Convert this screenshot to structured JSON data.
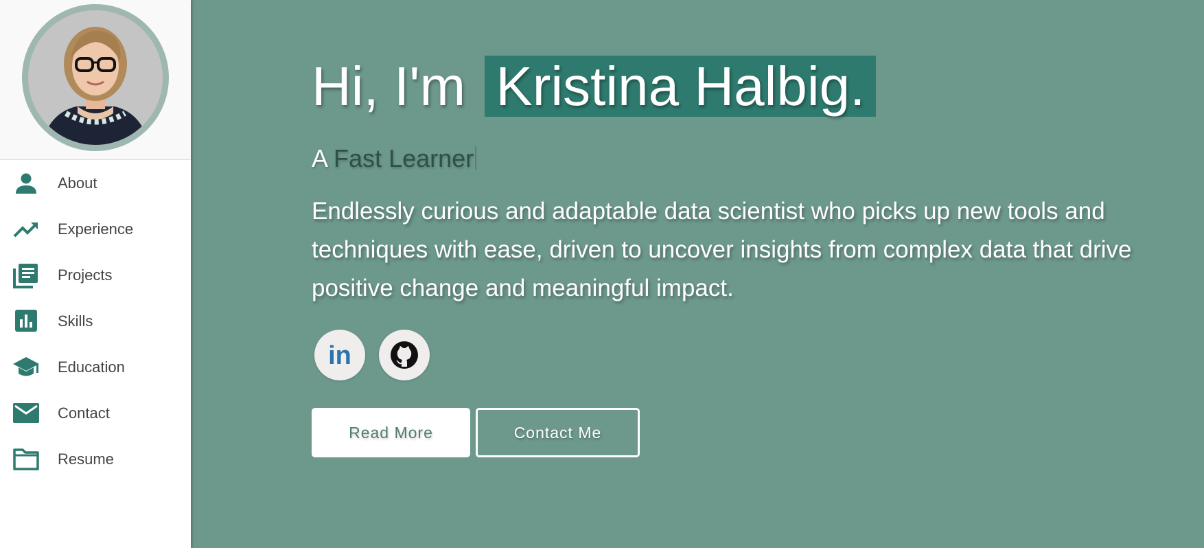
{
  "sidebar": {
    "items": [
      {
        "label": "About",
        "icon": "person-icon"
      },
      {
        "label": "Experience",
        "icon": "trending-up-icon"
      },
      {
        "label": "Projects",
        "icon": "library-books-icon"
      },
      {
        "label": "Skills",
        "icon": "bar-chart-icon"
      },
      {
        "label": "Education",
        "icon": "graduation-cap-icon"
      },
      {
        "label": "Contact",
        "icon": "mail-icon"
      },
      {
        "label": "Resume",
        "icon": "folder-icon"
      }
    ]
  },
  "hero": {
    "greeting": "Hi, I'm",
    "name": "Kristina Halbig.",
    "role_prefix": "A",
    "role_typed": "Fast Learner",
    "bio": "Endlessly curious and adaptable data scientist who picks up new tools and techniques with ease, driven to uncover insights from complex data that drive positive change and meaningful impact.",
    "social": [
      {
        "icon": "linkedin-icon",
        "text": "in"
      },
      {
        "icon": "github-icon"
      }
    ],
    "buttons": {
      "read_more": "Read More",
      "contact_me": "Contact Me"
    }
  },
  "colors": {
    "background": "#6d988c",
    "accent": "#2e7a6e",
    "icon": "#2e7a6e"
  }
}
